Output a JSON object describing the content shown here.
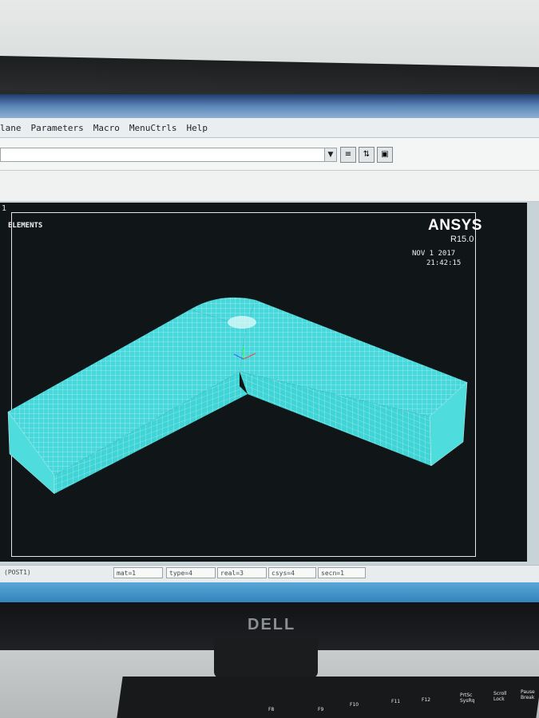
{
  "menubar": {
    "items": [
      "lane",
      "Parameters",
      "Macro",
      "MenuCtrls",
      "Help"
    ]
  },
  "graphics": {
    "window_number": "1",
    "plot_label": "ELEMENTS",
    "logo": "ANSYS",
    "version": "R15.0",
    "date": "NOV  1 2017",
    "time": "21:42:15"
  },
  "statusbar": {
    "mode": "(POST1)",
    "fields": [
      "mat=1",
      "type=4",
      "real=3",
      "csys=4",
      "secn=1"
    ]
  },
  "monitor": {
    "brand": "DELL"
  },
  "keyboard": {
    "keys": [
      "F8",
      "F9",
      "F10",
      "F11",
      "F12",
      "PrtSc SysRq",
      "Scroll Lock",
      "Pause Break"
    ]
  },
  "colors": {
    "mesh": "#3fd4d6",
    "mesh_lines": "#ffffff",
    "graphics_bg": "#101518"
  }
}
